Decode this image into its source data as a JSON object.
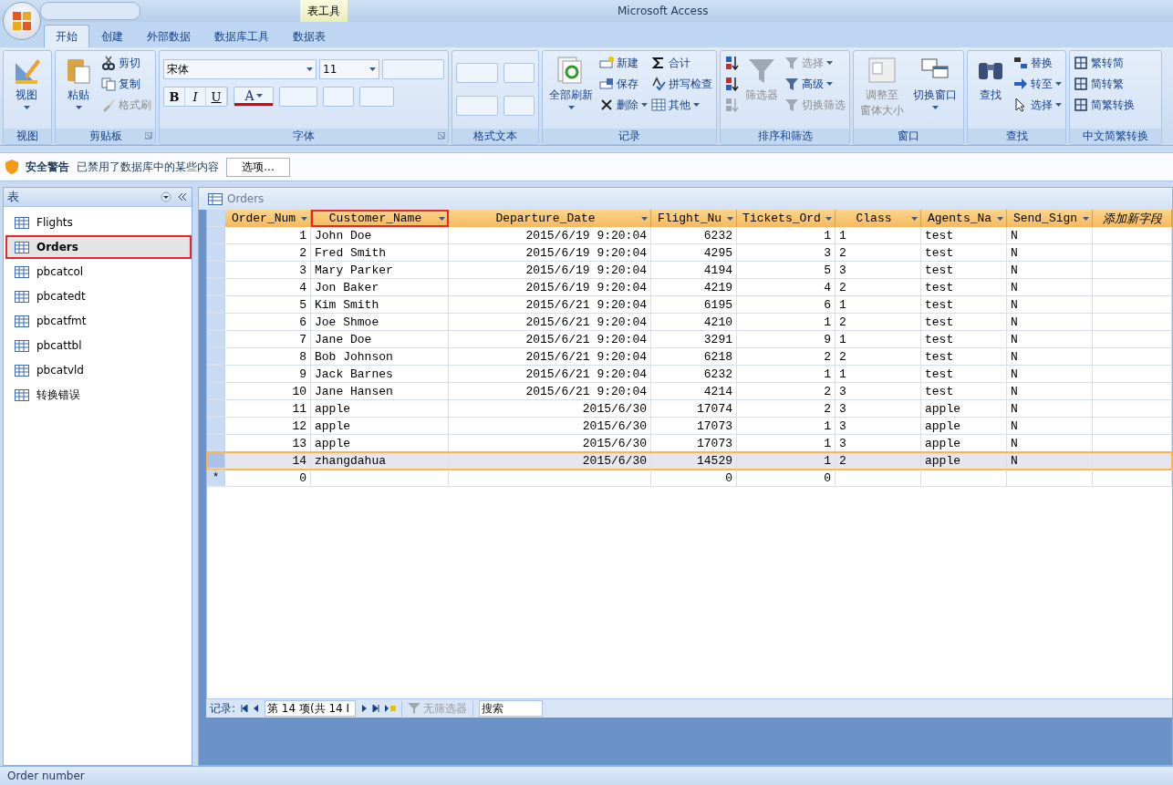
{
  "window": {
    "title": "Microsoft Access",
    "context_tab": "表工具"
  },
  "ribbon_tabs": [
    {
      "label": "开始",
      "selected": true
    },
    {
      "label": "创建",
      "selected": false
    },
    {
      "label": "外部数据",
      "selected": false
    },
    {
      "label": "数据库工具",
      "selected": false
    },
    {
      "label": "数据表",
      "selected": false
    }
  ],
  "ribbon_groups": [
    {
      "title": "视图",
      "kind": "buttons",
      "launcher": false,
      "items": [
        {
          "label": "视图",
          "kind": "large",
          "dropdown": true,
          "disabled": false
        }
      ]
    },
    {
      "title": "剪贴板",
      "kind": "buttons",
      "launcher": true,
      "items": [
        {
          "label": "粘贴",
          "kind": "large",
          "dropdown": true,
          "disabled": false
        },
        {
          "label": "剪切",
          "kind": "small",
          "dropdown": false,
          "disabled": false
        },
        {
          "label": "复制",
          "kind": "small",
          "dropdown": false,
          "disabled": false
        },
        {
          "label": "格式刷",
          "kind": "small",
          "dropdown": false,
          "disabled": true
        }
      ]
    },
    {
      "title": "字体",
      "kind": "font",
      "launcher": true,
      "font": "宋体",
      "font_size": "11",
      "styles": [
        "B",
        "I",
        "U"
      ],
      "color_letter": "A"
    },
    {
      "title": "格式文本",
      "kind": "format",
      "launcher": false
    },
    {
      "title": "记录",
      "kind": "buttons",
      "launcher": false,
      "items": [
        {
          "label": "全部刷新",
          "kind": "large",
          "dropdown": true,
          "disabled": false
        },
        {
          "label": "新建",
          "kind": "small",
          "dropdown": false,
          "disabled": false
        },
        {
          "label": "保存",
          "kind": "small",
          "dropdown": false,
          "disabled": false
        },
        {
          "label": "删除",
          "kind": "small",
          "dropdown": true,
          "disabled": false
        },
        {
          "label": "合计",
          "kind": "small",
          "dropdown": false,
          "disabled": false
        },
        {
          "label": "拼写检查",
          "kind": "small",
          "dropdown": false,
          "disabled": false
        },
        {
          "label": "其他",
          "kind": "small",
          "dropdown": true,
          "disabled": false
        }
      ]
    },
    {
      "title": "排序和筛选",
      "kind": "buttons",
      "launcher": false,
      "items": [
        {
          "kind": "icon",
          "dropdown": false,
          "disabled": false
        },
        {
          "kind": "icon",
          "dropdown": false,
          "disabled": false
        },
        {
          "kind": "icon",
          "dropdown": false,
          "disabled": true
        },
        {
          "label": "筛选器",
          "kind": "large",
          "dropdown": false,
          "disabled": true
        },
        {
          "label": "选择",
          "kind": "small",
          "dropdown": true,
          "disabled": true
        },
        {
          "label": "高级",
          "kind": "small",
          "dropdown": true,
          "disabled": false
        },
        {
          "label": "切换筛选",
          "kind": "small",
          "dropdown": false,
          "disabled": true
        }
      ]
    },
    {
      "title": "窗口",
      "kind": "buttons",
      "launcher": false,
      "items": [
        {
          "lines": [
            "调整至",
            "窗体大小"
          ],
          "kind": "large",
          "dropdown": false,
          "disabled": true
        },
        {
          "label": "切换窗口",
          "kind": "large",
          "dropdown": true,
          "disabled": false
        }
      ]
    },
    {
      "title": "查找",
      "kind": "buttons",
      "launcher": false,
      "items": [
        {
          "label": "查找",
          "kind": "large",
          "dropdown": false,
          "disabled": false
        },
        {
          "label": "替换",
          "kind": "small",
          "dropdown": false,
          "disabled": false
        },
        {
          "label": "转至",
          "kind": "small",
          "dropdown": true,
          "disabled": false
        },
        {
          "label": "选择",
          "kind": "small",
          "dropdown": true,
          "disabled": false
        }
      ]
    },
    {
      "title": "中文简繁转换",
      "kind": "buttons",
      "launcher": false,
      "items": [
        {
          "label": "繁转简",
          "kind": "small",
          "dropdown": false,
          "disabled": false
        },
        {
          "label": "简转繁",
          "kind": "small",
          "dropdown": false,
          "disabled": false
        },
        {
          "label": "简繁转换",
          "kind": "small",
          "dropdown": false,
          "disabled": false
        }
      ]
    }
  ],
  "security_bar": {
    "title": "安全警告",
    "message": "已禁用了数据库中的某些内容",
    "button": "选项..."
  },
  "nav_pane": {
    "title": "表",
    "items": [
      {
        "label": "Flights",
        "selected": false
      },
      {
        "label": "Orders",
        "selected": true
      },
      {
        "label": "pbcatcol",
        "selected": false
      },
      {
        "label": "pbcatedt",
        "selected": false
      },
      {
        "label": "pbcatfmt",
        "selected": false
      },
      {
        "label": "pbcattbl",
        "selected": false
      },
      {
        "label": "pbcatvld",
        "selected": false
      },
      {
        "label": "转换错误",
        "selected": false
      }
    ]
  },
  "document": {
    "title": "Orders",
    "columns": [
      {
        "label": "Order_Num",
        "kind": "number",
        "selected": false
      },
      {
        "label": "Customer_Name",
        "kind": "text",
        "selected": true
      },
      {
        "label": "Departure_Date",
        "kind": "number",
        "selected": false
      },
      {
        "label": "Flight_Nu",
        "kind": "number",
        "selected": false
      },
      {
        "label": "Tickets_Ord",
        "kind": "number",
        "selected": false
      },
      {
        "label": "Class",
        "kind": "text",
        "selected": false
      },
      {
        "label": "Agents_Na",
        "kind": "text",
        "selected": false
      },
      {
        "label": "Send_Sign",
        "kind": "text",
        "selected": false
      },
      {
        "label": "添加新字段",
        "kind": "add",
        "selected": false
      }
    ],
    "rows": [
      {
        "selected": false,
        "cells": [
          "1",
          "John Doe",
          "2015/6/19 9:20:04",
          "6232",
          "1",
          "1",
          "test",
          "N"
        ]
      },
      {
        "selected": false,
        "cells": [
          "2",
          "Fred Smith",
          "2015/6/19 9:20:04",
          "4295",
          "3",
          "2",
          "test",
          "N"
        ]
      },
      {
        "selected": false,
        "cells": [
          "3",
          "Mary Parker",
          "2015/6/19 9:20:04",
          "4194",
          "5",
          "3",
          "test",
          "N"
        ]
      },
      {
        "selected": false,
        "cells": [
          "4",
          "Jon Baker",
          "2015/6/19 9:20:04",
          "4219",
          "4",
          "2",
          "test",
          "N"
        ]
      },
      {
        "selected": false,
        "cells": [
          "5",
          "Kim Smith",
          "2015/6/21 9:20:04",
          "6195",
          "6",
          "1",
          "test",
          "N"
        ]
      },
      {
        "selected": false,
        "cells": [
          "6",
          "Joe Shmoe",
          "2015/6/21 9:20:04",
          "4210",
          "1",
          "2",
          "test",
          "N"
        ]
      },
      {
        "selected": false,
        "cells": [
          "7",
          "Jane Doe",
          "2015/6/21 9:20:04",
          "3291",
          "9",
          "1",
          "test",
          "N"
        ]
      },
      {
        "selected": false,
        "cells": [
          "8",
          "Bob Johnson",
          "2015/6/21 9:20:04",
          "6218",
          "2",
          "2",
          "test",
          "N"
        ]
      },
      {
        "selected": false,
        "cells": [
          "9",
          "Jack Barnes",
          "2015/6/21 9:20:04",
          "6232",
          "1",
          "1",
          "test",
          "N"
        ]
      },
      {
        "selected": false,
        "cells": [
          "10",
          "Jane Hansen",
          "2015/6/21 9:20:04",
          "4214",
          "2",
          "3",
          "test",
          "N"
        ]
      },
      {
        "selected": false,
        "cells": [
          "11",
          "apple",
          "2015/6/30",
          "17074",
          "2",
          "3",
          "apple",
          "N"
        ]
      },
      {
        "selected": false,
        "cells": [
          "12",
          "apple",
          "2015/6/30",
          "17073",
          "1",
          "3",
          "apple",
          "N"
        ]
      },
      {
        "selected": false,
        "cells": [
          "13",
          "apple",
          "2015/6/30",
          "17073",
          "1",
          "3",
          "apple",
          "N"
        ]
      },
      {
        "selected": true,
        "cells": [
          "14",
          "zhangdahua",
          "2015/6/30",
          "14529",
          "1",
          "2",
          "apple",
          "N"
        ]
      }
    ],
    "new_row": {
      "marker": "*",
      "cells": [
        "0",
        null,
        null,
        "0",
        "0",
        null,
        null,
        null,
        null
      ]
    },
    "record_nav": {
      "label": "记录:",
      "position": "第 14 项(共 14 I",
      "filter": "无筛选器",
      "filter_disabled": true,
      "search_placeholder": "搜索"
    }
  },
  "status_bar": "Order number"
}
